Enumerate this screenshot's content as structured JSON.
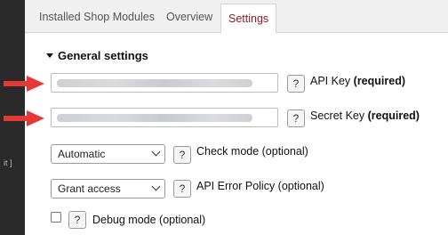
{
  "sidebar": {
    "fragment": "it ]"
  },
  "tabs": [
    {
      "label": "Installed Shop Modules"
    },
    {
      "label": "Overview"
    },
    {
      "label": "Settings",
      "active": true
    }
  ],
  "section": {
    "title": "General settings"
  },
  "fields": {
    "api_key": {
      "label": "API Key",
      "suffix": "(required)",
      "help": "?"
    },
    "secret_key": {
      "label": "Secret Key",
      "suffix": "(required)",
      "help": "?"
    },
    "check_mode": {
      "value": "Automatic",
      "label": "Check mode (optional)",
      "help": "?"
    },
    "error_policy": {
      "value": "Grant access",
      "label": "API Error Policy (optional)",
      "help": "?"
    },
    "debug_mode": {
      "checked": false,
      "label": "Debug mode (optional)",
      "help": "?"
    }
  },
  "colors": {
    "active_tab_text": "#8b1a1a",
    "arrow": "#e53935",
    "tab_bg": "#f0f0f0",
    "sidebar_bg": "#2a2a2a"
  }
}
